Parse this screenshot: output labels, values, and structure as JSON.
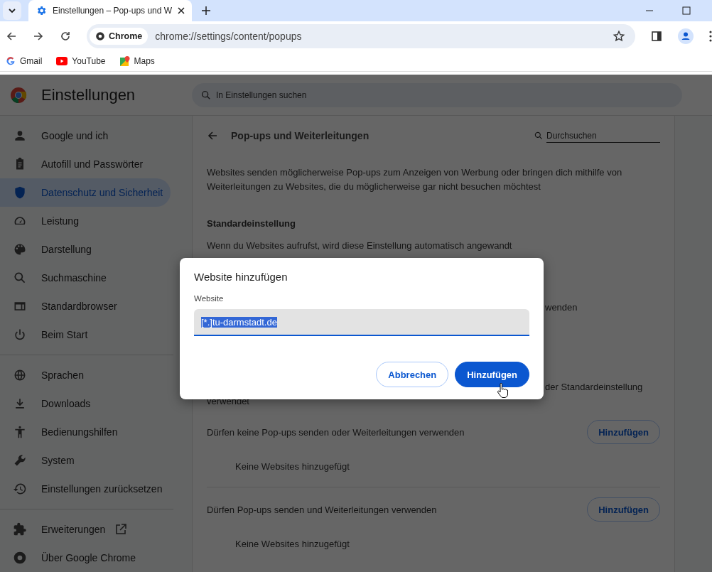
{
  "browser": {
    "tabs": [
      {
        "title": "Einstellungen – Pop-ups und W",
        "selected": true
      }
    ],
    "address": {
      "chip": "Chrome",
      "url": "chrome://settings/content/popups"
    },
    "bookmarks": [
      {
        "label": "Gmail"
      },
      {
        "label": "YouTube"
      },
      {
        "label": "Maps"
      }
    ]
  },
  "settings": {
    "title": "Einstellungen",
    "search_placeholder": "In Einstellungen suchen",
    "sidebar": [
      [
        {
          "label": "Google und ich",
          "selected": false
        },
        {
          "label": "Autofill und Passwörter",
          "selected": false
        },
        {
          "label": "Datenschutz und Sicherheit",
          "selected": true
        },
        {
          "label": "Leistung",
          "selected": false
        },
        {
          "label": "Darstellung",
          "selected": false
        },
        {
          "label": "Suchmaschine",
          "selected": false
        },
        {
          "label": "Standardbrowser",
          "selected": false
        },
        {
          "label": "Beim Start",
          "selected": false
        }
      ],
      [
        {
          "label": "Sprachen",
          "selected": false
        },
        {
          "label": "Downloads",
          "selected": false
        },
        {
          "label": "Bedienungshilfen",
          "selected": false
        },
        {
          "label": "System",
          "selected": false
        },
        {
          "label": "Einstellungen zurücksetzen",
          "selected": false
        }
      ],
      [
        {
          "label": "Erweiterungen",
          "selected": false,
          "external": true
        },
        {
          "label": "Über Google Chrome",
          "selected": false,
          "external": false
        }
      ]
    ],
    "page": {
      "title": "Pop-ups und Weiterleitungen",
      "search_placeholder": "Durchsuchen",
      "description": "Websites senden möglicherweise Pop-ups zum Anzeigen von Werbung oder bringen dich mithilfe von Weiterleitungen zu Websites, die du möglicherweise gar nicht besuchen möchtest",
      "default_heading": "Standardeinstellung",
      "default_note": "Wenn du Websites aufrufst, wird diese Einstellung automatisch angewandt",
      "obscured": [
        "wenden",
        "der Standardeinstellung",
        "verwendet"
      ],
      "lists": [
        {
          "label": "Dürfen keine Pop-ups senden oder Weiterleitungen verwenden",
          "button": "Hinzufügen",
          "empty": "Keine Websites hinzugefügt"
        },
        {
          "label": "Dürfen Pop-ups senden und Weiterleitungen verwenden",
          "button": "Hinzufügen",
          "empty": "Keine Websites hinzugefügt"
        }
      ]
    }
  },
  "dialog": {
    "title": "Website hinzufügen",
    "field_label": "Website",
    "value": "[*.]tu-darmstadt.de",
    "value_selected": true,
    "buttons": [
      {
        "label": "Abbrechen",
        "kind": "secondary"
      },
      {
        "label": "Hinzufügen",
        "kind": "primary"
      }
    ]
  }
}
